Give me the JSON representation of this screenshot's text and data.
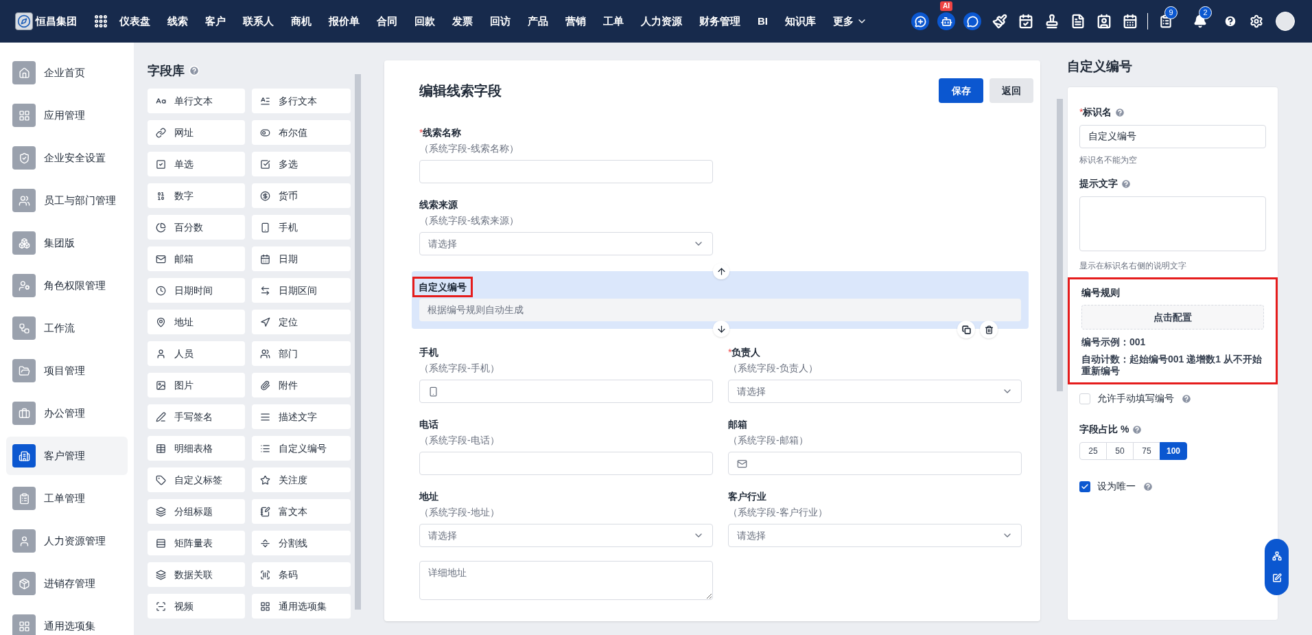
{
  "topbar": {
    "brand": "恒昌集团",
    "nav": [
      "仪表盘",
      "线索",
      "客户",
      "联系人",
      "商机",
      "报价单",
      "合同",
      "回款",
      "发票",
      "回访",
      "产品",
      "营销",
      "工单",
      "人力资源",
      "财务管理",
      "BI",
      "知识库"
    ],
    "more": "更多",
    "ai_badge": "AI",
    "badges": [
      "9",
      "2"
    ]
  },
  "sidebar": {
    "items": [
      {
        "label": "企业首页",
        "selected": false
      },
      {
        "label": "应用管理",
        "selected": false
      },
      {
        "label": "企业安全设置",
        "selected": false
      },
      {
        "label": "员工与部门管理",
        "selected": false
      },
      {
        "label": "集团版",
        "selected": false
      },
      {
        "label": "角色权限管理",
        "selected": false
      },
      {
        "label": "工作流",
        "selected": false
      },
      {
        "label": "项目管理",
        "selected": false
      },
      {
        "label": "办公管理",
        "selected": false
      },
      {
        "label": "客户管理",
        "selected": true
      },
      {
        "label": "工单管理",
        "selected": false
      },
      {
        "label": "人力资源管理",
        "selected": false
      },
      {
        "label": "进销存管理",
        "selected": false
      },
      {
        "label": "通用选项集",
        "selected": false
      }
    ]
  },
  "field_library": {
    "title": "字段库",
    "items": [
      "单行文本",
      "多行文本",
      "网址",
      "布尔值",
      "单选",
      "多选",
      "数字",
      "货币",
      "百分数",
      "手机",
      "邮箱",
      "日期",
      "日期时间",
      "日期区间",
      "地址",
      "定位",
      "人员",
      "部门",
      "图片",
      "附件",
      "手写签名",
      "描述文字",
      "明细表格",
      "自定义编号",
      "自定义标签",
      "关注度",
      "分组标题",
      "富文本",
      "矩阵量表",
      "分割线",
      "数据关联",
      "条码",
      "视频",
      "通用选项集"
    ]
  },
  "editor": {
    "title": "编辑线索字段",
    "save": "保存",
    "back": "返回",
    "rows": [
      [
        {
          "kind": "text",
          "label": "线索名称",
          "required_mark": "*",
          "note": "（系统字段-线索名称）",
          "selected": false,
          "annotated": false
        }
      ],
      [
        {
          "kind": "select",
          "label": "线索来源",
          "note": "（系统字段-线索来源）",
          "placeholder": "请选择",
          "selected": false,
          "annotated": false
        }
      ],
      [
        {
          "kind": "auto",
          "label": "自定义编号",
          "placeholder": "根据编号规则自动生成",
          "selected": true,
          "annotated": true
        }
      ],
      [
        {
          "kind": "phone",
          "label": "手机",
          "note": "（系统字段-手机）",
          "selected": false,
          "annotated": false
        },
        {
          "kind": "select",
          "label": "负责人",
          "required_mark": "*",
          "note": "（系统字段-负责人）",
          "placeholder": "请选择",
          "selected": false,
          "annotated": false
        }
      ],
      [
        {
          "kind": "text",
          "label": "电话",
          "note": "（系统字段-电话）",
          "selected": false,
          "annotated": false
        },
        {
          "kind": "email",
          "label": "邮箱",
          "note": "（系统字段-邮箱）",
          "selected": false,
          "annotated": false
        }
      ],
      [
        {
          "kind": "select",
          "label": "地址",
          "note": "（系统字段-地址）",
          "placeholder": "请选择",
          "selected": false,
          "annotated": false
        },
        {
          "kind": "select",
          "label": "客户行业",
          "note": "（系统字段-客户行业）",
          "placeholder": "请选择",
          "selected": false,
          "annotated": false
        }
      ],
      [
        {
          "kind": "textarea",
          "placeholder": "详细地址",
          "selected": false
        }
      ]
    ]
  },
  "properties": {
    "title": "自定义编号",
    "name_field": {
      "label": "标识名",
      "required_mark": "*",
      "value": "自定义编号",
      "hint": "标识名不能为空"
    },
    "tip_field": {
      "label": "提示文字",
      "hint": "显示在标识名右侧的说明文字"
    },
    "rule": {
      "label": "编号规则",
      "button": "点击配置",
      "example": "编号示例：001",
      "auto_count": "自动计数：起始编号001 递增数1 从不开始重新编号",
      "annotated": true
    },
    "allow_manual": {
      "label": "允许手动填写编号",
      "checked": false
    },
    "width": {
      "label": "字段占比 %",
      "options": [
        {
          "label": "25",
          "selected": false
        },
        {
          "label": "50",
          "selected": false
        },
        {
          "label": "75",
          "selected": false
        },
        {
          "label": "100",
          "selected": true
        }
      ]
    },
    "unique": {
      "label": "设为唯一",
      "checked": true
    }
  }
}
